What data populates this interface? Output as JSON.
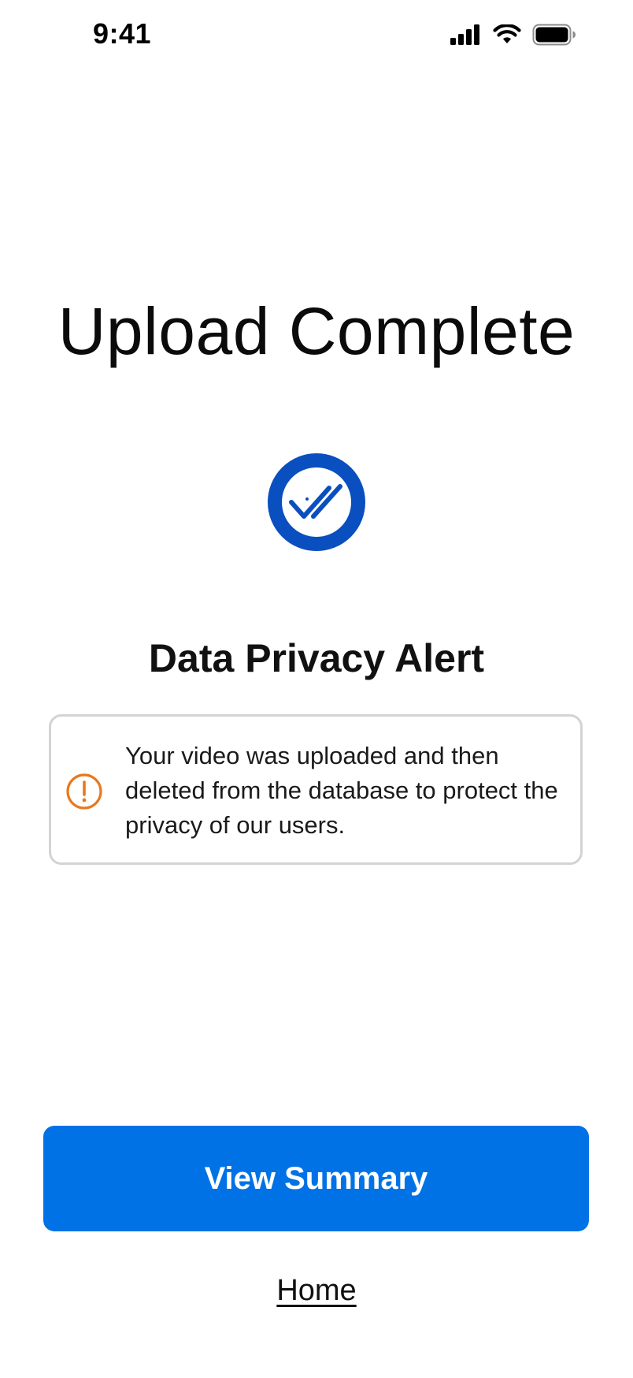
{
  "status_bar": {
    "time": "9:41",
    "icons": [
      "cellular-signal-icon",
      "wifi-icon",
      "battery-icon"
    ]
  },
  "main": {
    "title": "Upload Complete",
    "badge_icon": "double-check-circle-icon",
    "subtitle": "Data Privacy Alert",
    "alert": {
      "icon": "exclamation-circle-icon",
      "message": "Your video was uploaded and then deleted from the database to protect the privacy of our users."
    }
  },
  "actions": {
    "primary_label": "View Summary",
    "secondary_link": "Home"
  },
  "colors": {
    "accent_blue": "#0072e5",
    "badge_blue": "#0a4fbf",
    "warning_orange": "#e8781e",
    "card_border": "#d3d3d3"
  }
}
